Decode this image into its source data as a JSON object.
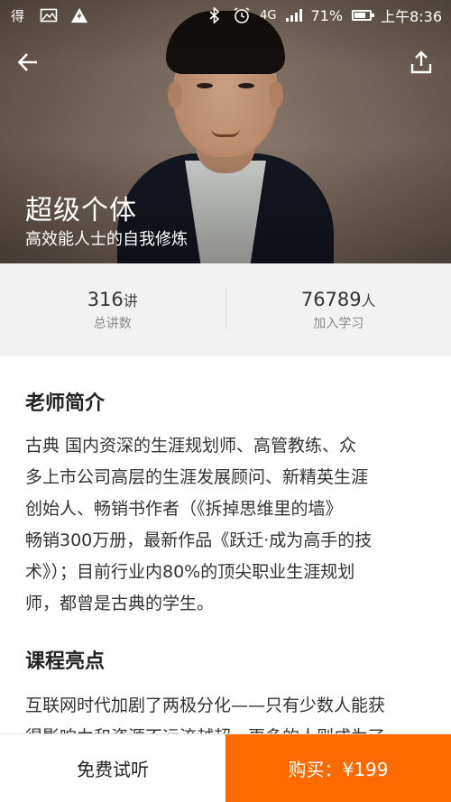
{
  "status_bar": {
    "battery": "71%",
    "time": "上午8:36",
    "network": "4G"
  },
  "hero": {
    "title": "超级个体",
    "subtitle": "高效能人士的自我修炼"
  },
  "stats": [
    {
      "value": "316",
      "unit": "讲",
      "label": "总讲数"
    },
    {
      "value": "76789",
      "unit": "人",
      "label": "加入学习"
    }
  ],
  "teacher": {
    "heading": "老师简介",
    "lines": [
      "古典 国内资深的生涯规划师、高管教练、众",
      "多上市公司高层的生涯发展顾问、新精英生涯",
      "创始人、畅销书作者（《拆掉思维里的墙》",
      "畅销300万册，最新作品《跃迁·成为高手的技",
      "术》）；目前行业内80%的顶尖职业生涯规划",
      "师，都曾是古典的学生。"
    ]
  },
  "highlights": {
    "heading": "课程亮点",
    "lines": [
      "互联网时代加剧了两极分化——只有少数人能获",
      "得影响力和资源不远流越超，更多的人则成为了"
    ]
  },
  "bottom_bar": {
    "trial_label": "免费试听",
    "buy_label": "购买：¥199"
  },
  "colors": {
    "accent": "#ff6a00",
    "stats_bg": "#f2f2f2"
  },
  "icons": {
    "back": "arrow-left-icon",
    "share": "share-upload-icon"
  }
}
